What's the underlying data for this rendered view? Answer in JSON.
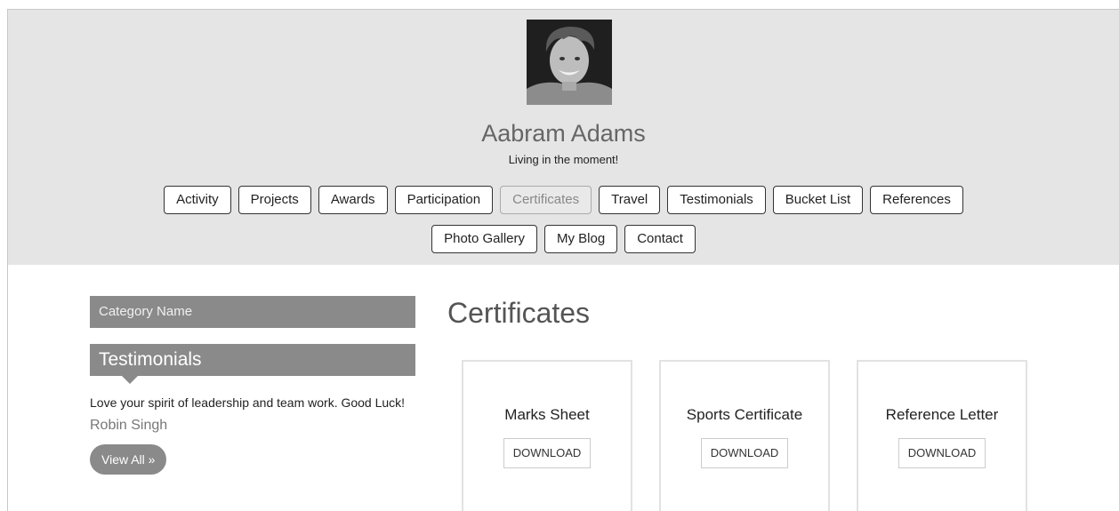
{
  "profile": {
    "name": "Aabram Adams",
    "tagline": "Living in the moment!"
  },
  "nav": {
    "row1": [
      "Activity",
      "Projects",
      "Awards",
      "Participation",
      "Certificates",
      "Travel",
      "Testimonials",
      "Bucket List",
      "References"
    ],
    "row2": [
      "Photo Gallery",
      "My Blog",
      "Contact"
    ],
    "active": "Certificates"
  },
  "sidebar": {
    "category_label": "Category Name",
    "testimonials_title": "Testimonials",
    "quote": "Love your spirit of leadership and team work. Good Luck!",
    "author": "Robin Singh",
    "view_all": "View All »"
  },
  "main": {
    "title": "Certificates",
    "cards": [
      {
        "title": "Marks Sheet",
        "button": "DOWNLOAD"
      },
      {
        "title": "Sports Certificate",
        "button": "DOWNLOAD"
      },
      {
        "title": "Reference Letter",
        "button": "DOWNLOAD"
      }
    ]
  },
  "colors": {
    "header_bg": "#e5e5e5",
    "sidebar_bar": "#8a8a8a",
    "accent_red": "#e11111"
  }
}
